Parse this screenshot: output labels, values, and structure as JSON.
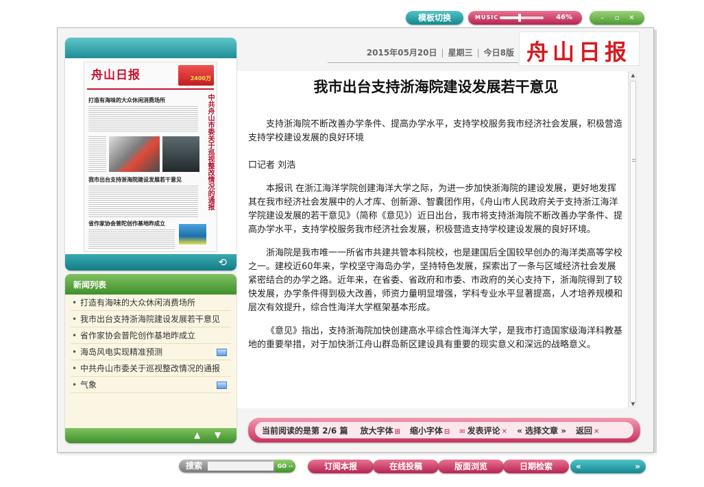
{
  "top": {
    "template_switch": "模板切换",
    "music_label": "MUSIC",
    "music_volume": 46,
    "music_percent": "46%"
  },
  "window_controls": [
    "–",
    "▫",
    "✕"
  ],
  "newspaper": {
    "logo": "舟山日报",
    "date": "2015年05月20日",
    "weekday": "星期三",
    "edition": "今日8版"
  },
  "thumbnail": {
    "masthead": "舟山日报",
    "ad_value": "2400万",
    "headline1": "打造有海味的大众休闲消费场所",
    "headline2": "我市出台支持浙海院建设发展若干意见",
    "headline3": "省作家协会普陀创作基地昨成立",
    "side_title": "中共舟山市委关于巡视整改情况的通报"
  },
  "news_list": {
    "title": "新闻列表",
    "items": [
      {
        "label": "打造有海味的大众休闲消费场所",
        "has_image": false
      },
      {
        "label": "我市出台支持浙海院建设发展若干意见",
        "has_image": false
      },
      {
        "label": "省作家协会普陀创作基地昨成立",
        "has_image": false
      },
      {
        "label": "海岛风电实现精准预测",
        "has_image": true
      },
      {
        "label": "中共舟山市委关于巡视整改情况的通报",
        "has_image": false
      },
      {
        "label": "气象",
        "has_image": true
      }
    ],
    "up_icon": "triangle-up-icon",
    "down_icon": "triangle-down-icon"
  },
  "article": {
    "title": "我市出台支持浙海院建设发展若干意见",
    "paragraphs": [
      "支持浙海院不断改善办学条件、提高办学水平，支持学校服务我市经济社会发展，积极营造支持学校建设发展的良好环境",
      "口记者  刘浩",
      "本报讯  在浙江海洋学院创建海洋大学之际，为进一步加快浙海院的建设发展，更好地发挥其在我市经济社会发展中的人才库、创新源、智囊团作用，《舟山市人民政府关于支持浙江海洋学院建设发展的若干意见》（简称《意见》）近日出台，我市将支持浙海院不断改善办学条件、提高办学水平，支持学校服务我市经济社会发展，积极营造支持学校建设发展的良好环境。",
      "浙海院是我市唯一一所省市共建共管本科院校，也是建国后全国较早创办的海洋类高等学校之一。建校近60年来，学校坚守海岛办学，坚持特色发展，探索出了一条与区域经济社会发展紧密结合的办学之路。近年来，在省委、省政府和市委、市政府的关心支持下，浙海院得到了较快发展，办学条件得到极大改善，师资力量明显增强，学科专业水平显著提高，人才培养规模和层次有效提升，综合性海洋大学框架基本形成。",
      "《意见》指出，支持浙海院加快创建高水平综合性海洋大学，是我市打造国家级海洋科教基地的重要举措，对于加快浙江舟山群岛新区建设具有重要的现实意义和深远的战略意义。"
    ]
  },
  "toolbar": {
    "status": "当前阅读的是第 2/6 篇",
    "enlarge": "放大字体",
    "shrink": "缩小字体",
    "comment": "发表评论",
    "select_prefix": "«",
    "select": "选择文章",
    "select_suffix": "»",
    "back": "返回"
  },
  "bottom": {
    "search_label": "搜索",
    "search_value": "",
    "go_label": "GO ››",
    "subscribe": "订阅本报",
    "submit": "在线投稿",
    "browse": "版面浏览",
    "date_search": "日期检索",
    "prev": "«",
    "next": "»"
  },
  "colors": {
    "teal": "#1f8d95",
    "pink": "#c9315d",
    "green": "#4d9b32",
    "logo_red": "#d7191f"
  }
}
